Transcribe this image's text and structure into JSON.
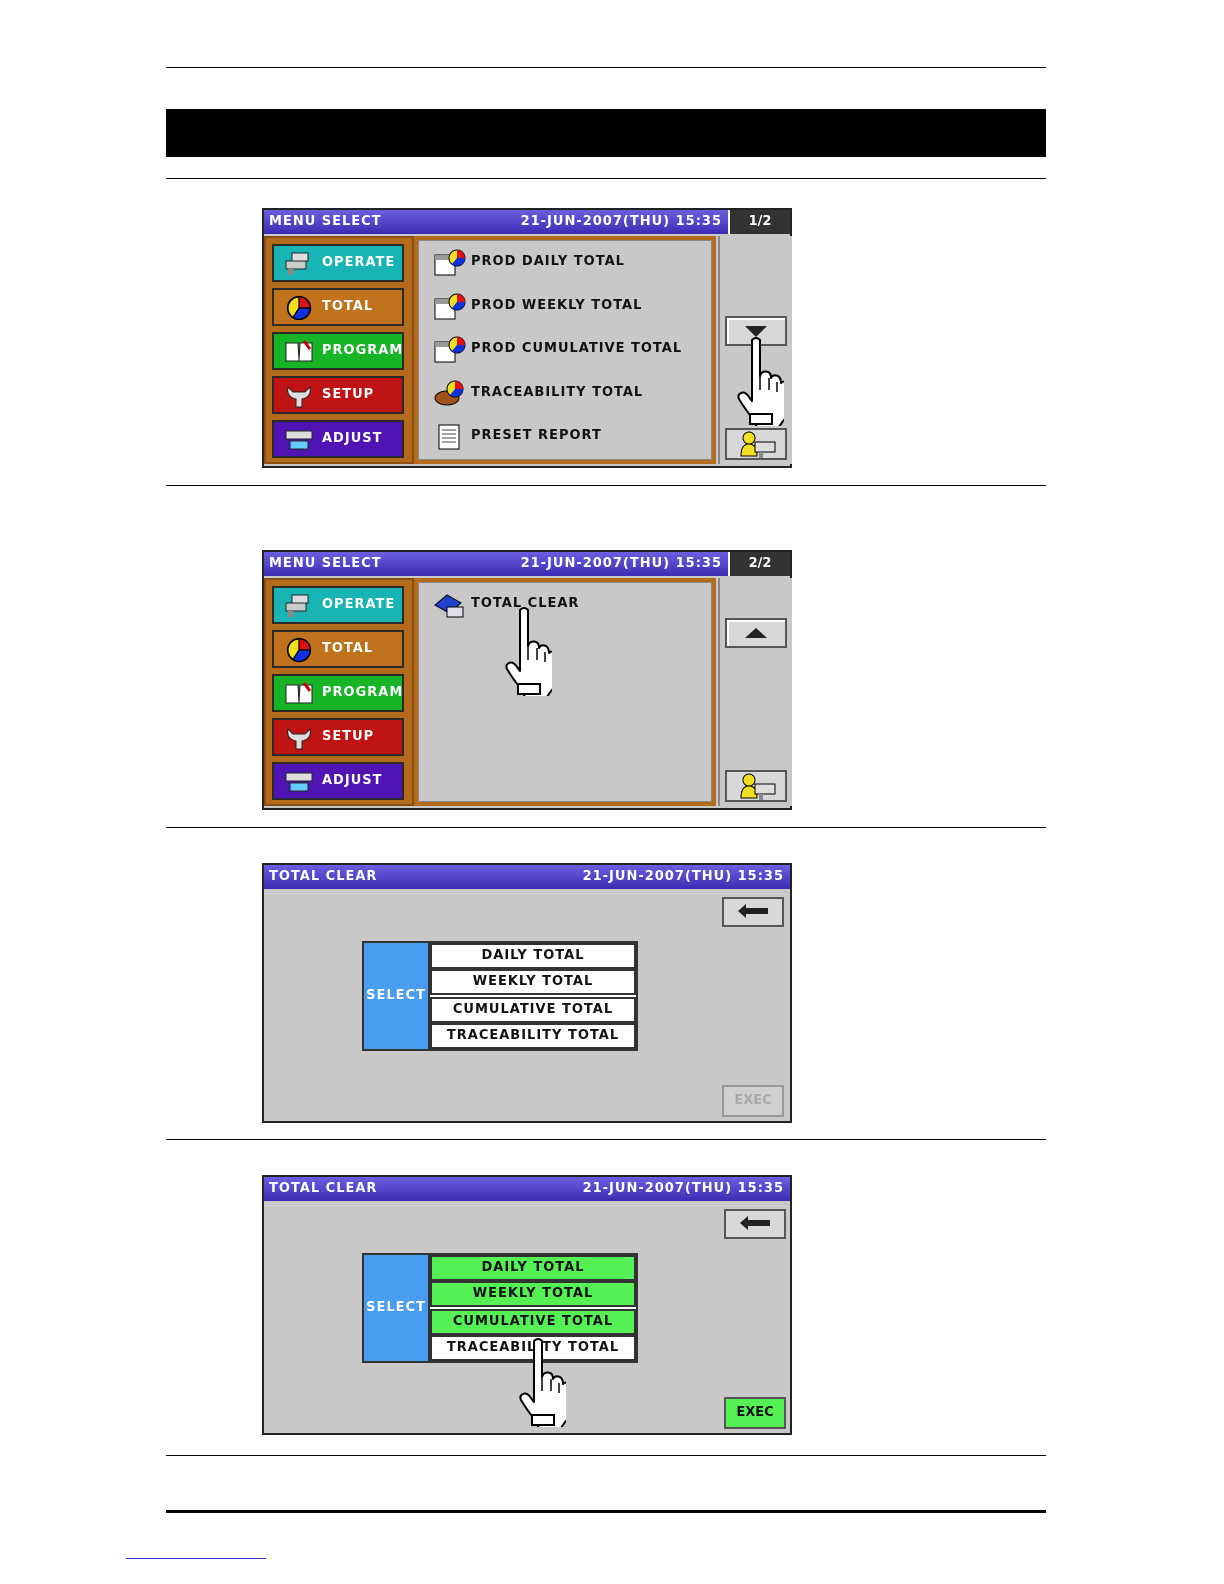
{
  "screen1": {
    "title": "MENU SELECT",
    "datetime": "21-JUN-2007(THU)  15:35",
    "page": "1/2",
    "left_menu": [
      "OPERATE",
      "TOTAL",
      "PROGRAM",
      "SETUP",
      "ADJUST"
    ],
    "items": [
      "PROD DAILY TOTAL",
      "PROD WEEKLY TOTAL",
      "PROD CUMULATIVE TOTAL",
      "TRACEABILITY TOTAL",
      "PRESET REPORT"
    ]
  },
  "screen2": {
    "title": "MENU SELECT",
    "datetime": "21-JUN-2007(THU)  15:35",
    "page": "2/2",
    "left_menu": [
      "OPERATE",
      "TOTAL",
      "PROGRAM",
      "SETUP",
      "ADJUST"
    ],
    "items": [
      "TOTAL CLEAR"
    ]
  },
  "screen3": {
    "title": "TOTAL CLEAR",
    "datetime": "21-JUN-2007(THU)  15:35",
    "select_label": "SELECT",
    "options": [
      "DAILY TOTAL",
      "WEEKLY TOTAL",
      "CUMULATIVE TOTAL",
      "TRACEABILITY TOTAL"
    ],
    "exec_label": "EXEC"
  },
  "screen4": {
    "title": "TOTAL CLEAR",
    "datetime": "21-JUN-2007(THU)  15:35",
    "select_label": "SELECT",
    "options": [
      "DAILY TOTAL",
      "WEEKLY TOTAL",
      "CUMULATIVE TOTAL",
      "TRACEABILITY TOTAL"
    ],
    "selected": [
      true,
      true,
      true,
      false
    ],
    "exec_label": "EXEC"
  },
  "colors": {
    "titlebar": "#4a3cc8",
    "selected_green": "#54f054",
    "select_blue": "#4a9cf0",
    "menu_frame": "#b46c1c"
  }
}
